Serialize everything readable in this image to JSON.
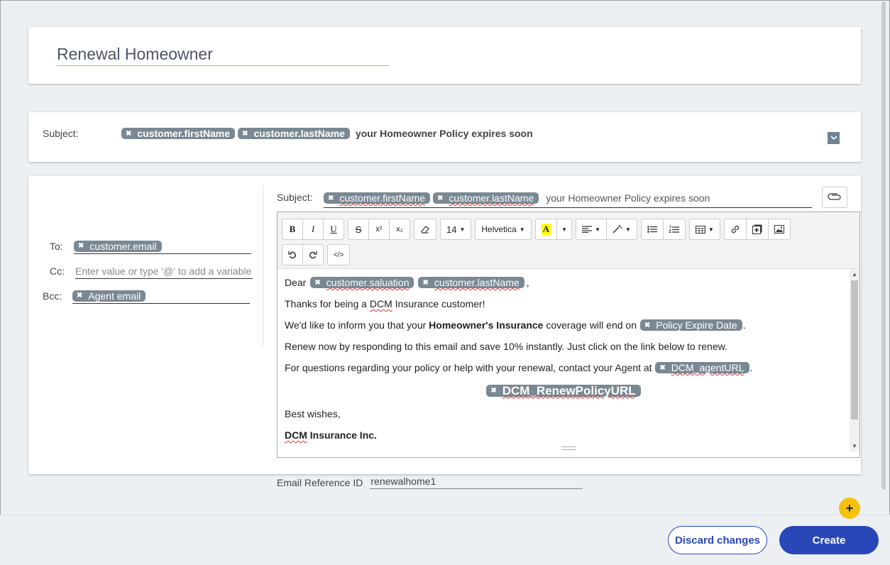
{
  "title_card": {
    "template_name": "Renewal Homeowner"
  },
  "subject_summary": {
    "label": "Subject:",
    "chips": [
      "customer.firstName",
      "customer.lastName"
    ],
    "text": "your Homeowner Policy expires soon"
  },
  "recipients": {
    "to_label": "To:",
    "to_chip": "customer.email",
    "cc_label": "Cc:",
    "cc_placeholder": "Enter value or type '@' to add a variable",
    "bcc_label": "Bcc:",
    "bcc_chip": "Agent email"
  },
  "compose": {
    "subject_label": "Subject:",
    "subject_chips": [
      "customer.firstName",
      "customer.lastName"
    ],
    "subject_text": "your Homeowner Policy expires soon"
  },
  "toolbar": {
    "bold": "B",
    "italic": "I",
    "underline": "U",
    "strike": "S",
    "superscript": "x²",
    "subscript": "x₂",
    "font_size": "14",
    "font_name": "Helvetica",
    "highlight": "A",
    "code": "</>"
  },
  "body": {
    "greeting_prefix": "Dear",
    "greeting_chip1": "customer.saluation",
    "greeting_chip2": "customer.lastName",
    "greeting_suffix": ",",
    "line1_a": "Thanks for being a ",
    "line1_dcm": "DCM",
    "line1_b": " Insurance customer!",
    "line2_a": "We'd like to inform you that your ",
    "line2_bold": "Homeowner's Insurance",
    "line2_b": " coverage will end on ",
    "line2_chip": "Policy Expire Date",
    "line2_end": ".",
    "line3": "Renew now by responding to this email and save 10% instantly. Just click on the link below to renew.",
    "line4_a": "For questions regarding your policy or help with your renewal, contact your Agent at ",
    "line4_chip": "DCM_agentURL",
    "line4_end": ".",
    "renew_chip": "DCM_RenewPolicyURL",
    "closing": "Best wishes,",
    "signature_dcm": "DCM",
    "signature_rest": " Insurance Inc."
  },
  "reference": {
    "label": "Email Reference ID",
    "value": "renewalhome1"
  },
  "footer": {
    "add": "+",
    "discard": "Discard changes",
    "create": "Create"
  },
  "colors": {
    "accent": "#2a47b8",
    "chip": "#7a8893",
    "fab": "#f4c20d",
    "title_underline": "#e8b400"
  }
}
